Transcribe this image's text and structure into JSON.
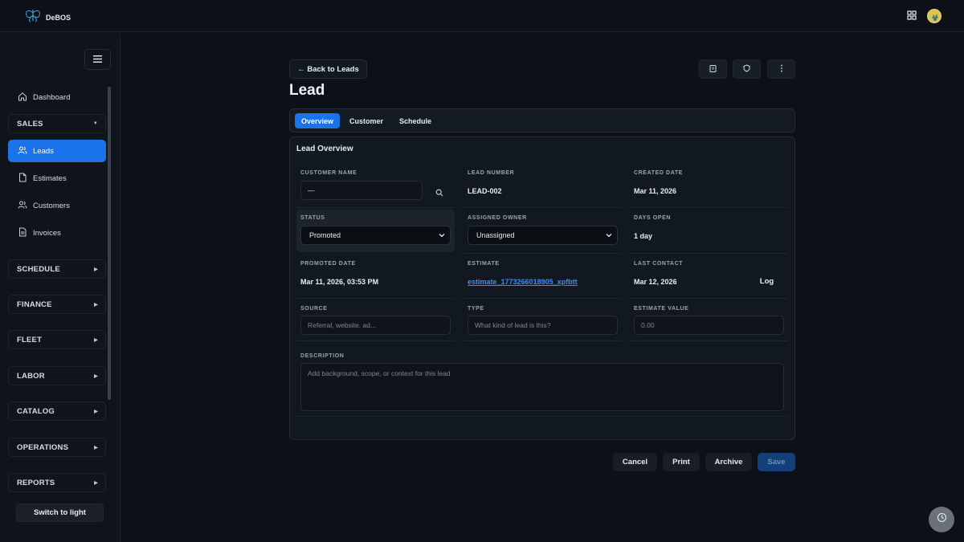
{
  "app": {
    "name": "DeBOS"
  },
  "sidebar": {
    "dashboard": "Dashboard",
    "sales": "SALES",
    "items": [
      {
        "label": "Leads"
      },
      {
        "label": "Estimates"
      },
      {
        "label": "Customers"
      },
      {
        "label": "Invoices"
      }
    ],
    "sections": [
      "SCHEDULE",
      "FINANCE",
      "FLEET",
      "LABOR",
      "CATALOG",
      "OPERATIONS",
      "REPORTS"
    ],
    "switch_theme": "Switch to light"
  },
  "header": {
    "back": "← Back to Leads",
    "title": "Lead"
  },
  "tabs": [
    "Overview",
    "Customer",
    "Schedule"
  ],
  "overview": {
    "title": "Lead Overview",
    "customer_name": {
      "label": "CUSTOMER NAME",
      "value": "—"
    },
    "lead_number": {
      "label": "LEAD NUMBER",
      "value": "LEAD-002"
    },
    "created_date": {
      "label": "CREATED DATE",
      "value": "Mar 11, 2026"
    },
    "status": {
      "label": "STATUS",
      "value": "Promoted"
    },
    "assigned_owner": {
      "label": "ASSIGNED OWNER",
      "value": "Unassigned"
    },
    "days_open": {
      "label": "DAYS OPEN",
      "value": "1 day"
    },
    "promoted_date": {
      "label": "PROMOTED DATE",
      "value": "Mar 11, 2026, 03:53 PM"
    },
    "estimate": {
      "label": "ESTIMATE",
      "value": "estimate_1773266018905_xpfbtt"
    },
    "last_contact": {
      "label": "LAST CONTACT",
      "value": "Mar 12, 2026",
      "action": "Log"
    },
    "source": {
      "label": "SOURCE",
      "placeholder": "Referral, website, ad..."
    },
    "type": {
      "label": "TYPE",
      "placeholder": "What kind of lead is this?"
    },
    "estimate_value": {
      "label": "ESTIMATE VALUE",
      "placeholder": "0.00"
    },
    "description": {
      "label": "DESCRIPTION",
      "placeholder": "Add background, scope, or context for this lead"
    }
  },
  "actions": {
    "cancel": "Cancel",
    "print": "Print",
    "archive": "Archive",
    "save": "Save"
  },
  "colors": {
    "accent": "#1a73e8",
    "background": "#0d1117",
    "link": "#3d8bf2"
  }
}
